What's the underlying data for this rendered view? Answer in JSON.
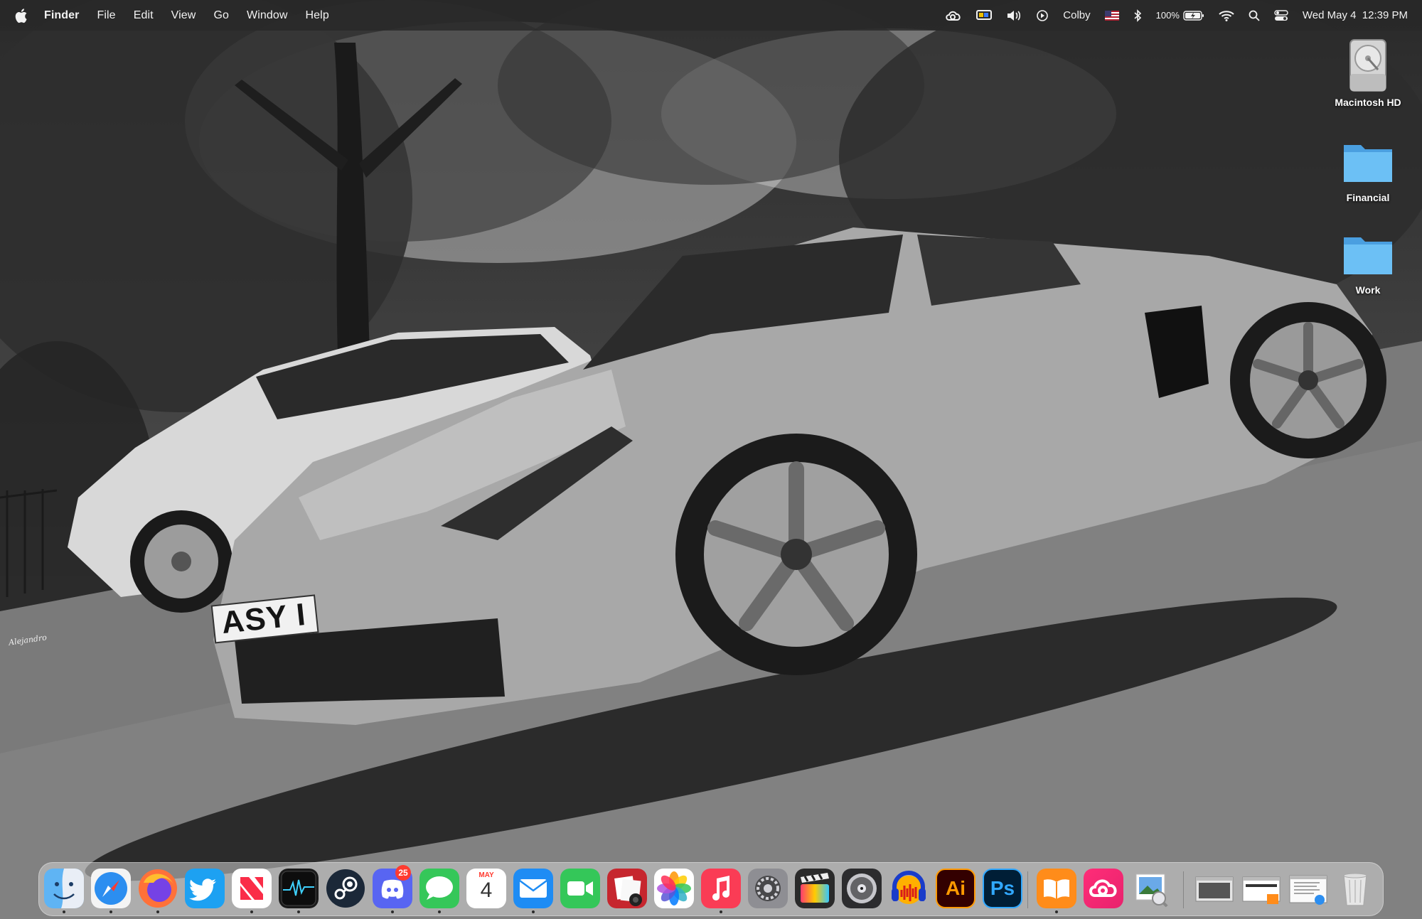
{
  "menubar": {
    "app_name": "Finder",
    "menus": [
      "File",
      "Edit",
      "View",
      "Go",
      "Window",
      "Help"
    ],
    "user_name": "Colby",
    "battery_percent": "100%",
    "datetime": "Wed May 4  12:39 PM"
  },
  "desktop_icons": [
    {
      "label": "Macintosh HD",
      "icon": "hard-drive-icon"
    },
    {
      "label": "Financial",
      "icon": "folder-icon"
    },
    {
      "label": "Work",
      "icon": "folder-icon"
    }
  ],
  "wallpaper": {
    "plate_text": "ASY I",
    "watermark": "Alejandro"
  },
  "dock": {
    "apps": [
      "Finder",
      "Safari",
      "Firefox",
      "Twitter",
      "News",
      "Activity Monitor",
      "Steam",
      "Discord",
      "Messages",
      "Calendar",
      "Mail",
      "FaceTime",
      "Photo Booth",
      "Photos",
      "Music",
      "System Preferences",
      "Final Cut Pro",
      "Logic",
      "Audacity",
      "Illustrator",
      "Photoshop",
      "Books",
      "Creative Cloud",
      "Preview",
      "Window 1",
      "Window 2",
      "Window 3",
      "Trash"
    ],
    "discord_badge": "25",
    "calendar_month": "MAY",
    "calendar_day": "4",
    "illustrator_label": "Ai",
    "photoshop_label": "Ps"
  }
}
